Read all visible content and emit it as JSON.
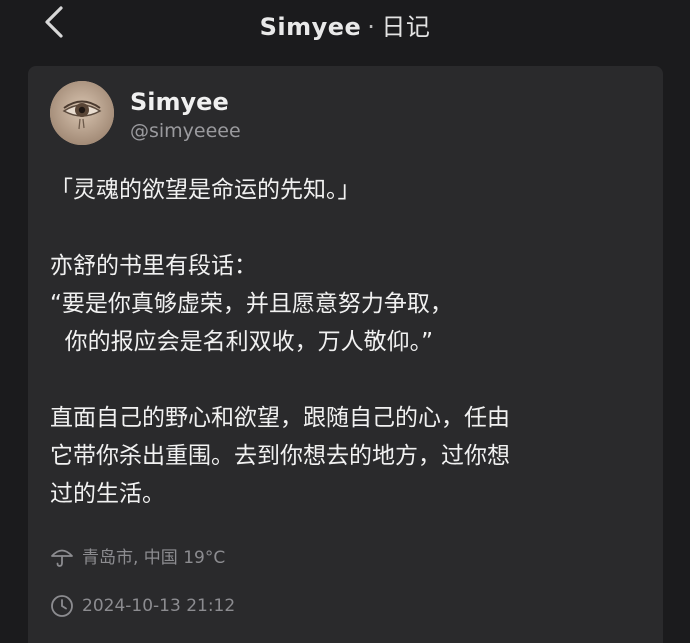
{
  "nav": {
    "title": "Simyee",
    "separator": "·",
    "subtitle": "日记",
    "back_icon": "chevron-left-icon"
  },
  "post": {
    "author_name": "Simyee",
    "author_handle": "@simyeeee",
    "lines": [
      "「灵魂的欲望是命运的先知。」",
      "",
      "亦舒的书里有段话：",
      "“要是你真够虚荣，并且愿意努力争取，",
      "  你的报应会是名利双收，万人敬仰。”",
      "",
      "直面自己的野心和欲望，跟随自己的心，任由",
      "它带你杀出重围。去到你想去的地方，过你想",
      "过的生活。"
    ],
    "location": "青岛市, 中国 19°C",
    "location_icon": "umbrella-icon",
    "timestamp": "2024-10-13 21:12",
    "time_icon": "clock-icon"
  }
}
